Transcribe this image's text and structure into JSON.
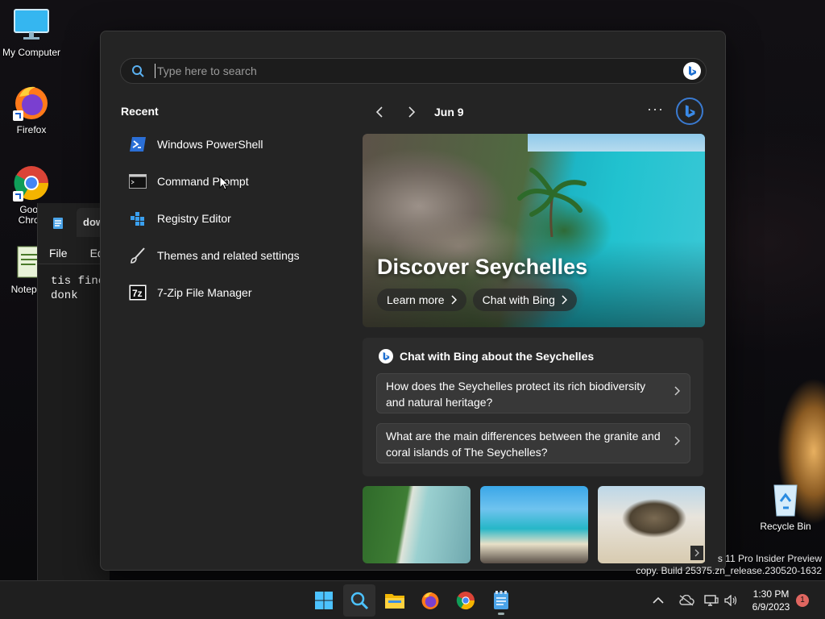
{
  "desktop": {
    "icons": [
      {
        "label": "My Computer",
        "icon": "monitor-icon"
      },
      {
        "label": "Firefox",
        "icon": "firefox-icon"
      },
      {
        "label": "Goog\nChron",
        "icon": "chrome-icon"
      },
      {
        "label": "Notepa",
        "icon": "notepad-icon"
      },
      {
        "label": "Recycle Bin",
        "icon": "recycle-bin-icon"
      }
    ]
  },
  "notepad": {
    "tab_label": "dow",
    "menu": [
      "File",
      "Ed"
    ],
    "text": "tis fine\ndonk"
  },
  "search": {
    "placeholder": "Type here to search"
  },
  "recent": {
    "title": "Recent",
    "items": [
      {
        "label": "Windows PowerShell",
        "icon": "powershell-icon"
      },
      {
        "label": "Command Prompt",
        "icon": "command-prompt-icon"
      },
      {
        "label": "Registry Editor",
        "icon": "registry-editor-icon"
      },
      {
        "label": "Themes and related settings",
        "icon": "brush-icon"
      },
      {
        "label": "7-Zip File Manager",
        "icon": "7zip-icon"
      }
    ]
  },
  "highlights": {
    "date": "Jun 9",
    "more": "···",
    "hero": {
      "title": "Discover Seychelles",
      "learn_more": "Learn more",
      "chat_with_bing": "Chat with Bing"
    },
    "chat": {
      "heading": "Chat with Bing about the Seychelles",
      "questions": [
        "How does the Seychelles protect its rich biodiversity and natural heritage?",
        "What are the main differences between the granite and coral islands of The Seychelles?"
      ]
    }
  },
  "watermark": {
    "line1": "s 11 Pro Insider Preview",
    "line2": "copy. Build 25375.zn_release.230520-1632"
  },
  "taskbar": {
    "apps": [
      "start-icon",
      "search-icon",
      "file-explorer-icon",
      "firefox-icon",
      "chrome-icon",
      "notepad-icon"
    ],
    "time": "1:30 PM",
    "date": "6/9/2023",
    "notification_count": "1"
  }
}
